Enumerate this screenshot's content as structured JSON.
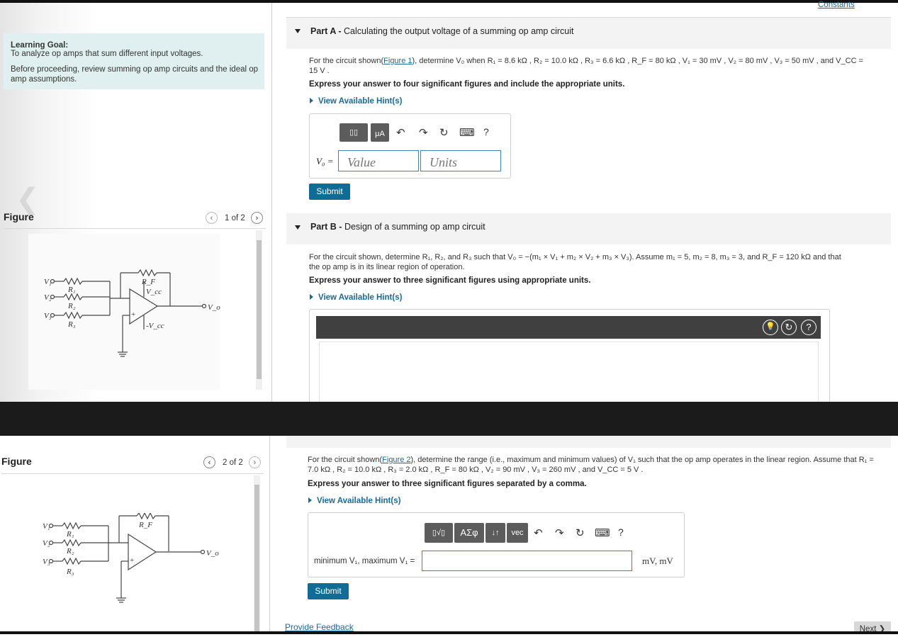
{
  "top": {
    "constants_link": "Constants"
  },
  "learning_goal": {
    "title": "Learning Goal:",
    "line1": "To analyze op amps that sum different input voltages.",
    "line2": "Before proceeding, review summing op amp circuits and the ideal op amp assumptions."
  },
  "figure1": {
    "label": "Figure",
    "pager": "1 of 2"
  },
  "figure2": {
    "label": "Figure",
    "pager": "2 of 2"
  },
  "circuit_labels": {
    "v1": "V₁",
    "v2": "V₂",
    "v3": "V₃",
    "r1": "R₁",
    "r2": "R₂",
    "r3": "R₃",
    "rf": "R_F",
    "vcc": "V_cc",
    "neg_vcc": "-V_cc",
    "vo": "V_o",
    "plus": "+",
    "minus": "−"
  },
  "part_a": {
    "prefix": "Part A -",
    "title": "Calculating the output voltage of a summing op amp circuit",
    "q_before": "For the circuit shown(",
    "q_link": "Figure 1",
    "q_after": "), determine V₀ when R₁ = 8.6 kΩ , R₂ = 10.0 kΩ , R₃ = 6.6 kΩ , R_F = 80 kΩ , V₁ = 30 mV , V₂ = 80 mV , V₃ = 50 mV , and V_CC =",
    "q_line2": "15 V .",
    "instruction": "Express your answer to four significant figures and include the appropriate units.",
    "hint": "View Available Hint(s)",
    "toolbar": {
      "template_btn": "▯▯",
      "units_btn": "μA",
      "undo": "↶",
      "redo": "↷",
      "reset": "↻",
      "keyboard": "⌨",
      "help": "?"
    },
    "var_label": "V₀ =",
    "value_placeholder": "Value",
    "units_placeholder": "Units",
    "submit": "Submit"
  },
  "part_b": {
    "prefix": "Part B -",
    "title": "Design of a summing op amp circuit",
    "q_line1": "For the circuit shown, determine R₁, R₂, and R₃ such that V₀ = −(m₁ × V₁ + m₂ × V₂ + m₃ × V₃). Assume m₁ = 5, m₂ = 8, m₃ = 3, and R_F = 120 kΩ and that",
    "q_line2": "the op amp is in its linear region of operation.",
    "instruction": "Express your answer to three significant figures using appropriate units.",
    "hint": "View Available Hint(s)",
    "icons": {
      "hint_bulb": "💡",
      "reset": "↻",
      "help": "?"
    }
  },
  "part_c": {
    "q_before": "For the circuit shown(",
    "q_link": "Figure 2",
    "q_after": "), determine the range (i.e., maximum and minimum values) of V₁ such that the op amp operates in the linear region. Assume that R₁ =",
    "q_line2": "7.0 kΩ , R₂ = 10.0 kΩ , R₃ = 2.0 kΩ , R_F = 80 kΩ , V₂ = 90 mV , V₃ = 260 mV , and V_CC = 5 V .",
    "instruction": "Express your answer to three significant figures separated by a comma.",
    "hint": "View Available Hint(s)",
    "toolbar": {
      "template_btn": "▯√▯",
      "greek_btn": "ΑΣφ",
      "arrows_btn": "↓↑",
      "vec_btn": "vec",
      "undo": "↶",
      "redo": "↷",
      "reset": "↻",
      "keyboard": "⌨",
      "help": "?"
    },
    "var_label": "minimum V₁, maximum V₁ =",
    "unit_label": "mV, mV",
    "submit": "Submit"
  },
  "footer": {
    "feedback": "Provide Feedback",
    "next": "Next ❯"
  }
}
